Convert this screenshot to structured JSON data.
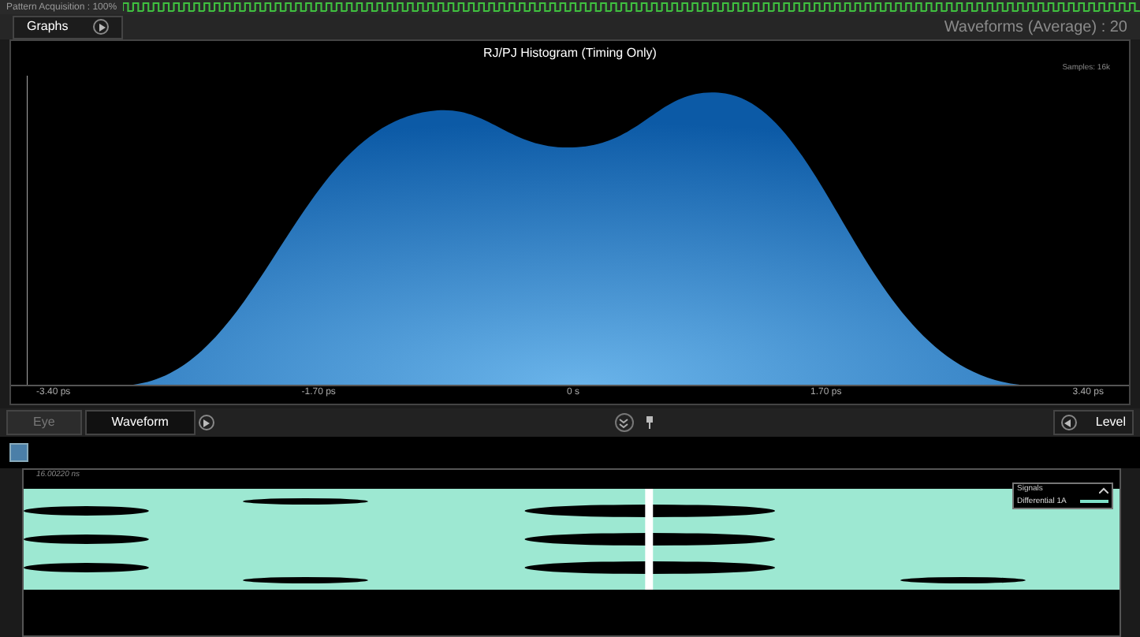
{
  "status_strip": {
    "label": "Pattern Acquisition : 100%"
  },
  "graphs_tab": {
    "label": "Graphs"
  },
  "header_info": "Waveforms (Average) : 20",
  "histogram": {
    "title": "RJ/PJ Histogram (Timing Only)",
    "samples": "Samples: 16k",
    "x_labels": [
      "-3.40 ps",
      "-1.70 ps",
      "0 s",
      "1.70 ps",
      "3.40 ps"
    ]
  },
  "tabs": [
    {
      "label": "Eye",
      "selected": false
    },
    {
      "label": "Waveform",
      "selected": true
    }
  ],
  "right_tab": {
    "label": "Level"
  },
  "waveform": {
    "time_label": "16.00220 ns",
    "legend": {
      "title": "Signals",
      "items": [
        {
          "name": "Differential 1A",
          "color": "#7ee0c8"
        }
      ]
    }
  }
}
